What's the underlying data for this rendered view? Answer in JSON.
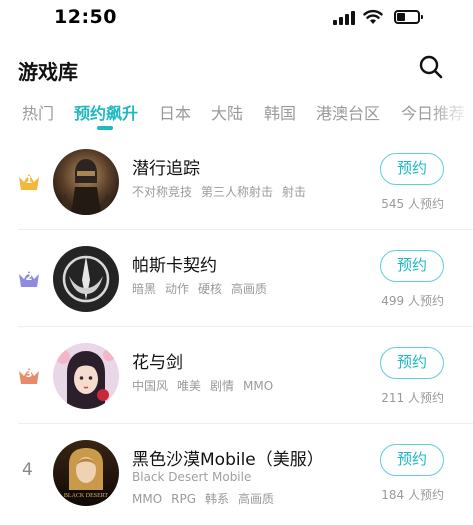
{
  "status_bar": {
    "time": "12:50"
  },
  "header": {
    "title": "游戏库"
  },
  "tabs": [
    {
      "label": "热门"
    },
    {
      "label": "预约飙升"
    },
    {
      "label": "日本"
    },
    {
      "label": "大陆"
    },
    {
      "label": "韩国"
    },
    {
      "label": "港澳台区"
    },
    {
      "label": "今日推荐"
    }
  ],
  "games": [
    {
      "rank": "1",
      "name": "潜行追踪",
      "subtitle": "",
      "tags": [
        "不对称竞技",
        "第三人称射击",
        "射击"
      ],
      "button": "预约",
      "count": "545 人预约"
    },
    {
      "rank": "2",
      "name": "帕斯卡契约",
      "subtitle": "",
      "tags": [
        "暗黑",
        "动作",
        "硬核",
        "高画质"
      ],
      "button": "预约",
      "count": "499 人预约"
    },
    {
      "rank": "3",
      "name": "花与剑",
      "subtitle": "",
      "tags": [
        "中国风",
        "唯美",
        "剧情",
        "MMO"
      ],
      "button": "预约",
      "count": "211 人预约"
    },
    {
      "rank": "4",
      "name": "黑色沙漠Mobile（美服）",
      "subtitle": "Black Desert Mobile",
      "tags": [
        "MMO",
        "RPG",
        "韩系",
        "高画质"
      ],
      "button": "预约",
      "count": "184 人预约"
    }
  ],
  "colors": {
    "accent": "#1fb8c3",
    "gold": "#f4b73a",
    "purple": "#8e8be0",
    "bronze": "#e98a6a"
  }
}
